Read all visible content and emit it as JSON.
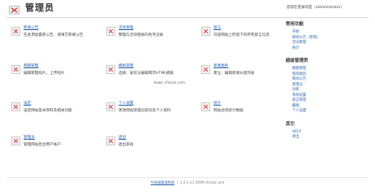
{
  "header": {
    "title": "管理员",
    "welcome": "您现在登录的是（administrator）",
    "title_icon": "admin-folder-icon"
  },
  "tiles": [
    {
      "title": "新闻公告",
      "desc": "在此添加最新公告，请填写新闻公告"
    },
    {
      "title": "活动管理",
      "desc": "整理与活动相关的各项记录"
    },
    {
      "title": "留言",
      "desc": "浏览网站上所留下的所有留言信息"
    },
    {
      "title": "相册管理",
      "desc": "编辑管理照片，上传照片"
    },
    {
      "title": "模板管理",
      "desc": "选择、安装与编辑网页HTML模板"
    },
    {
      "title": "新闻类别",
      "desc": "建立、编辑新闻分类列表"
    },
    {
      "title": "设定",
      "desc": "设定网站基本资料及相关功能"
    },
    {
      "title": "个人设置",
      "desc": "更改网站管理员密码及个人资料"
    },
    {
      "title": "统计",
      "desc": "网站访问统计数据"
    },
    {
      "title": "管理员",
      "desc": "管理网站后台用户帐户"
    },
    {
      "title": "退出",
      "desc": "退出系统"
    }
  ],
  "watermark": "down.chinaz.com",
  "sidebar": {
    "sections": [
      {
        "title": "常用功能",
        "items": [
          "开始",
          "新闻公告（新增）",
          "活动管理",
          "统计"
        ]
      },
      {
        "title": "超级管理员",
        "items": [
          "模板管理",
          "新闻类别",
          "新闻公告",
          "管理员",
          "访客",
          "系统设置",
          "留言管理",
          "截图",
          "个人设置"
        ]
      },
      {
        "title": "其它",
        "items": [
          "HELP",
          "退出"
        ]
      }
    ]
  },
  "footer": {
    "link": "牛网络管理系统",
    "version": "1.0.1 (c) 2009 chinaz.com"
  },
  "colors": {
    "link": "#2a62b0",
    "text": "#333333",
    "icon_cross": "#d23b3b"
  }
}
